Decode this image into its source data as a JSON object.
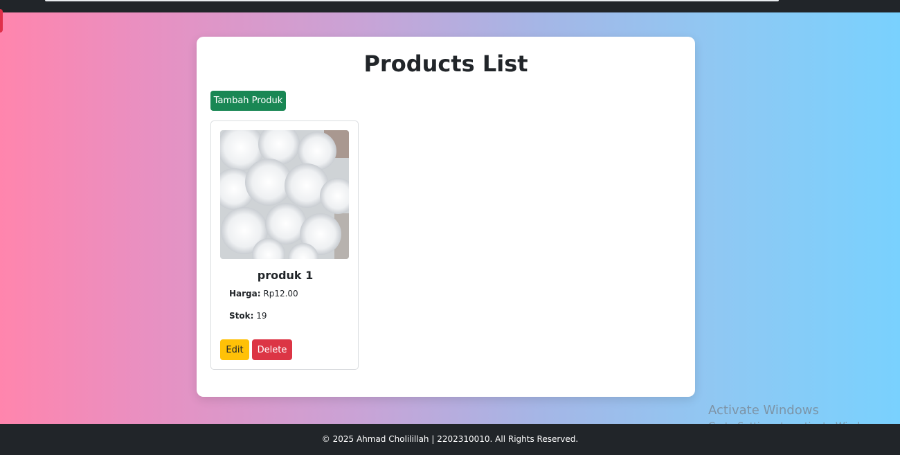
{
  "page": {
    "title": "Products List",
    "add_button_label": "Tambah Produk"
  },
  "products": [
    {
      "name": "produk 1",
      "price_label": "Harga:",
      "price_value": "Rp12.00",
      "stock_label": "Stok:",
      "stock_value": "19",
      "image": "cotton-image",
      "edit_label": "Edit",
      "delete_label": "Delete"
    }
  ],
  "footer": {
    "text": "© 2025 Ahmad Cholilillah | 2202310010. All Rights Reserved."
  },
  "watermark": {
    "title": "Activate Windows",
    "subtitle": "Go to Settings to activate Windows."
  },
  "colors": {
    "add_button": "#198754",
    "edit_button": "#ffc107",
    "delete_button": "#dc3545",
    "footer": "#212529"
  }
}
